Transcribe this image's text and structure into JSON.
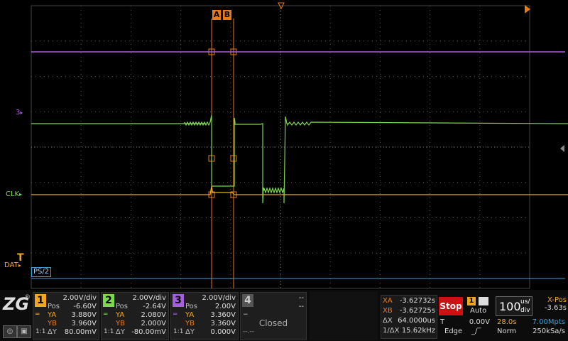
{
  "colors": {
    "ch1": "#f0a820",
    "ch2": "#7ed84b",
    "ch3": "#a65de0",
    "cursor": "#e87a1a",
    "grid": "#5a5a5a",
    "stop": "#d01010"
  },
  "cursors": {
    "a_label": "A",
    "b_label": "B"
  },
  "waveform_labels": {
    "purple": "3",
    "green": "CLK",
    "data": "DAT",
    "decode": "PS/2"
  },
  "channels": [
    {
      "num": "1",
      "vdiv": "2.00V/div",
      "pos_label": "Pos",
      "pos": "-6.60V",
      "ya_label": "YA",
      "ya": "3.880V",
      "yb_label": "YB",
      "yb": "3.960V",
      "dy_label": "ΔY",
      "dy": "80.00mV",
      "coupling": "1:1"
    },
    {
      "num": "2",
      "vdiv": "2.00V/div",
      "pos_label": "Pos",
      "pos": "-2.64V",
      "ya_label": "YA",
      "ya": "2.080V",
      "yb_label": "YB",
      "yb": "2.000V",
      "dy_label": "ΔY",
      "dy": "-80.00mV",
      "coupling": "1:1"
    },
    {
      "num": "3",
      "vdiv": "2.00V/div",
      "pos_label": "Pos",
      "pos": "2.00V",
      "ya_label": "YA",
      "ya": "3.360V",
      "yb_label": "YB",
      "yb": "3.360V",
      "dy_label": "ΔY",
      "dy": "0.000V",
      "coupling": "1:1"
    },
    {
      "num": "4",
      "vdiv": "--",
      "pos": "--",
      "status": "Closed",
      "dash": "--",
      "dash2": "--.--"
    }
  ],
  "cursor_readout": {
    "xa_label": "XA",
    "xa": "-3.62732s",
    "xb_label": "XB",
    "xb": "-3.62725s",
    "dx_label": "ΔX",
    "dx": "64.0000us",
    "inv_label": "1/ΔX",
    "inv": "15.62kHz"
  },
  "run_state": "Stop",
  "trigger": {
    "channel": "1",
    "mode": "Auto",
    "source_label": "T",
    "level": "0.00V",
    "type": "Edge"
  },
  "timebase": {
    "value": "100",
    "unit_top": "us/",
    "unit_bottom": "div"
  },
  "xpos": {
    "label": "X-Pos",
    "value": "-3.63s"
  },
  "acquisition": {
    "time": "28.0s",
    "points": "7.00Mpts",
    "mode": "Norm",
    "rate": "250kSa/s"
  }
}
